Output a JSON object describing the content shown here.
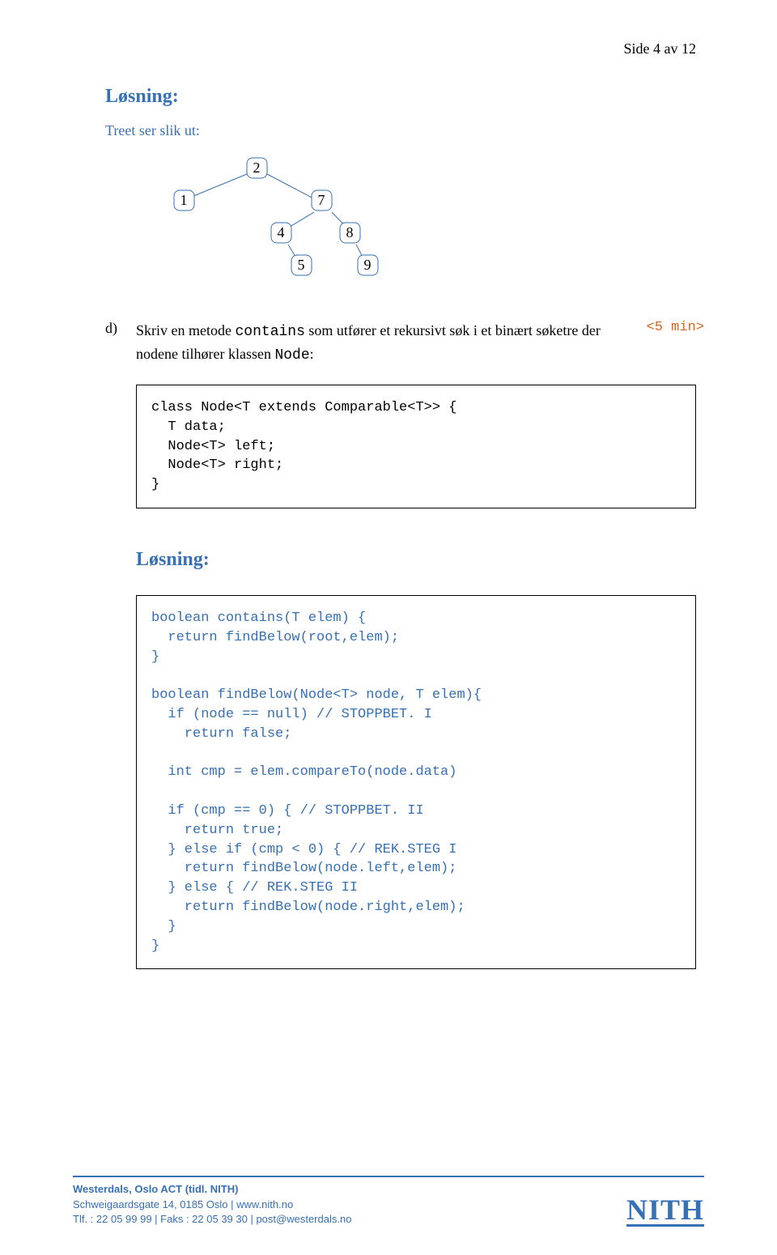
{
  "header": {
    "page_label": "Side 4 av 12"
  },
  "solution1": {
    "title": "Løsning:",
    "intro": "Treet ser slik ut:"
  },
  "tree": {
    "n1": "1",
    "n2": "2",
    "n4": "4",
    "n5": "5",
    "n7": "7",
    "n8": "8",
    "n9": "9"
  },
  "task": {
    "label": "d)",
    "text_pre": "Skriv en metode ",
    "code1": "contains",
    "text_mid": " som utfører et rekursivt søk i et binært søketre der nodene tilhører klassen ",
    "code2": "Node",
    "text_post": ":",
    "time": "<5 min>"
  },
  "code_class": "class Node<T extends Comparable<T>> {\n  T data;\n  Node<T> left;\n  Node<T> right;\n}",
  "solution2": {
    "title": "Løsning:"
  },
  "code_contains": "boolean contains(T elem) {\n  return findBelow(root,elem);\n}\n\nboolean findBelow(Node<T> node, T elem){\n  if (node == null) // STOPPBET. I\n    return false;\n\n  int cmp = elem.compareTo(node.data)\n\n  if (cmp == 0) { // STOPPBET. II\n    return true;\n  } else if (cmp < 0) { // REK.STEG I\n    return findBelow(node.left,elem);\n  } else { // REK.STEG II\n    return findBelow(node.right,elem);\n  }\n}",
  "chart_data": {
    "type": "tree",
    "root": 2,
    "nodes": [
      1,
      2,
      4,
      5,
      7,
      8,
      9
    ],
    "edges": [
      [
        2,
        1
      ],
      [
        2,
        7
      ],
      [
        7,
        4
      ],
      [
        7,
        8
      ],
      [
        4,
        5
      ],
      [
        8,
        9
      ]
    ],
    "description": "Binary search tree rooted at 2; left child 1; right child 7; 7 has left child 4 and right child 8; 4 has right child 5; 8 has right child 9."
  },
  "footer": {
    "line1_bold": "Westerdals, Oslo ACT (tidl. NITH)",
    "line2": "Schweigaardsgate 14, 0185 Oslo  |  www.nith.no",
    "line3": "Tlf. : 22 05 99 99  |  Faks : 22 05 39 30  |  post@westerdals.no",
    "logo": "NITH"
  }
}
